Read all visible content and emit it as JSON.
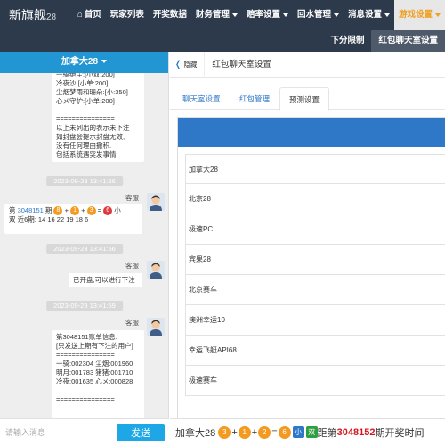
{
  "brand": {
    "name": "新旗舰",
    "version": "28"
  },
  "nav": [
    {
      "label": "首页",
      "icon": "home-icon",
      "dropdown": false
    },
    {
      "label": "玩家列表",
      "dropdown": false
    },
    {
      "label": "开奖数据",
      "dropdown": false
    },
    {
      "label": "财务管理",
      "dropdown": true
    },
    {
      "label": "赔率设置",
      "dropdown": true
    },
    {
      "label": "回水管理",
      "dropdown": true
    },
    {
      "label": "消息设置",
      "dropdown": true
    },
    {
      "label": "游戏设置",
      "dropdown": true,
      "active": true
    }
  ],
  "subnav": [
    {
      "label": "下分限制"
    },
    {
      "label": "红包聊天室设置",
      "active": true
    }
  ],
  "chat": {
    "room": "加拿大28",
    "messages": [
      {
        "text": "一骑绝尘:[小双:200]\n冷夜沙:[小单:200]\n尘烟梦雨和珊朵:[小:350]\n心メ守护:[小单:200]\n\n===============\n以上未列出的表示未下注\n如封盘会提示封盘无效,\n没有任何理由撒积.\n包括系统遇突发事情.",
        "sender": "",
        "time": ""
      },
      {
        "time": "2023-09-23 13:41:56",
        "sender": "客服",
        "issue_prefix": "第",
        "issue": "3048151",
        "issue_suffix": "期",
        "balls": [
          "8",
          "1",
          "3",
          "6"
        ],
        "result_tags": "小",
        "line2": "双 近6期: 14 16 22 19 18 6"
      },
      {
        "time": "2023-09-23 13:41:56",
        "sender": "客服",
        "text": "已开盘,可以进行下注"
      },
      {
        "time": "2023-09-23 13:41:59",
        "sender": "客服",
        "text": "第3048151账单信息:\n[只发送上期有下注的用户]\n===============\n一骑:002304 尘烟:001960\n明月:001783 猪猪:001710\n冷夜:001635 心メ:000828\n\n==============="
      }
    ],
    "input_placeholder": "请输入消息",
    "send_label": "发送"
  },
  "main": {
    "hide_label": "隐藏",
    "room_tab": "红包聊天室设置",
    "subtabs": [
      "聊天室设置",
      "红包管理",
      "预测设置"
    ],
    "active_subtab": 2,
    "games": [
      "加拿大28",
      "北京28",
      "极速PC",
      "宾果28",
      "北京赛车",
      "澳洲幸运10",
      "幸运飞艇API68",
      "极速赛车"
    ]
  },
  "footer": {
    "game": "加拿大28",
    "balls": [
      "3",
      "1",
      "2",
      "6"
    ],
    "tag_size": "小",
    "tag_parity": "双",
    "text_prefix": "距第",
    "issue": "3048152",
    "text_suffix": "期开奖时间"
  },
  "colors": {
    "topbar": "#2d3a4b",
    "accent_blue": "#2e78c7",
    "send_blue": "#1ea7e6",
    "ball_orange": "#f49a20",
    "ball_red": "#e0383e",
    "nav_active": "#f0a020"
  }
}
